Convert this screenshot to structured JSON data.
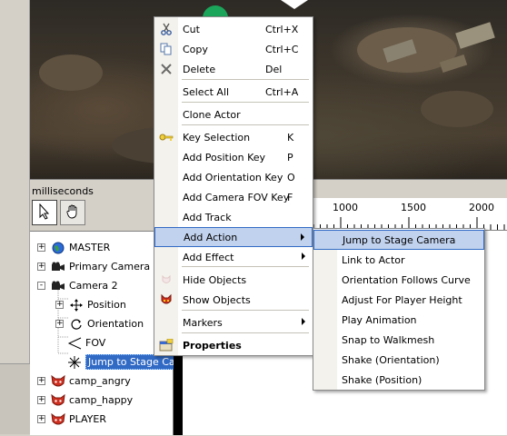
{
  "panel": {
    "time_unit": "milliseconds"
  },
  "ruler": {
    "labels": [
      "1000",
      "1500",
      "2000"
    ]
  },
  "tracks": [
    {
      "label": "MASTER",
      "icon": "globe-icon",
      "expander": "+"
    },
    {
      "label": "Primary Camera",
      "icon": "camera-icon",
      "expander": "+"
    },
    {
      "label": "Camera 2",
      "icon": "camera-icon",
      "expander": "-"
    },
    {
      "label": "Position",
      "icon": "move-arrows-icon",
      "expander": "+"
    },
    {
      "label": "Orientation",
      "icon": "rotate-icon",
      "expander": "+"
    },
    {
      "label": "FOV",
      "icon": "fov-angle-icon",
      "expander": ""
    },
    {
      "label": "Jump to Stage Cam",
      "icon": "action-star-icon",
      "expander": ""
    },
    {
      "label": "camp_angry",
      "icon": "actor-face-icon",
      "expander": "+"
    },
    {
      "label": "camp_happy",
      "icon": "actor-face-icon",
      "expander": "+"
    },
    {
      "label": "PLAYER",
      "icon": "actor-face-icon",
      "expander": "+"
    }
  ],
  "context_menu": {
    "items": [
      {
        "label": "Cut",
        "shortcut": "Ctrl+X",
        "icon": "scissors-icon"
      },
      {
        "label": "Copy",
        "shortcut": "Ctrl+C",
        "icon": "copy-icon"
      },
      {
        "label": "Delete",
        "shortcut": "Del",
        "icon": "delete-x-icon"
      },
      {
        "label": "Select All",
        "shortcut": "Ctrl+A",
        "icon": ""
      },
      {
        "label": "Clone Actor",
        "shortcut": "",
        "icon": ""
      },
      {
        "label": "Key Selection",
        "shortcut": "K",
        "icon": "key-icon"
      },
      {
        "label": "Add Position Key",
        "shortcut": "P",
        "icon": ""
      },
      {
        "label": "Add Orientation Key",
        "shortcut": "O",
        "icon": ""
      },
      {
        "label": "Add Camera FOV Key",
        "shortcut": "F",
        "icon": ""
      },
      {
        "label": "Add Track",
        "shortcut": "",
        "icon": ""
      },
      {
        "label": "Add Action",
        "shortcut": "",
        "icon": "",
        "submenu": true
      },
      {
        "label": "Add Effect",
        "shortcut": "",
        "icon": "",
        "submenu": true
      },
      {
        "label": "Hide Objects",
        "shortcut": "",
        "icon": "hide-objects-icon"
      },
      {
        "label": "Show Objects",
        "shortcut": "",
        "icon": "show-objects-icon"
      },
      {
        "label": "Markers",
        "shortcut": "",
        "icon": "",
        "submenu": true
      },
      {
        "label": "Properties",
        "shortcut": "",
        "icon": "properties-icon"
      }
    ]
  },
  "action_submenu": {
    "items": [
      "Jump to Stage Camera",
      "Link to Actor",
      "Orientation Follows Curve",
      "Adjust For Player Height",
      "Play Animation",
      "Snap to Walkmesh",
      "Shake (Orientation)",
      "Shake (Position)"
    ]
  },
  "colors": {
    "highlight_fill": "#c1d2ee",
    "highlight_border": "#316ac5",
    "selection": "#316ac5"
  }
}
